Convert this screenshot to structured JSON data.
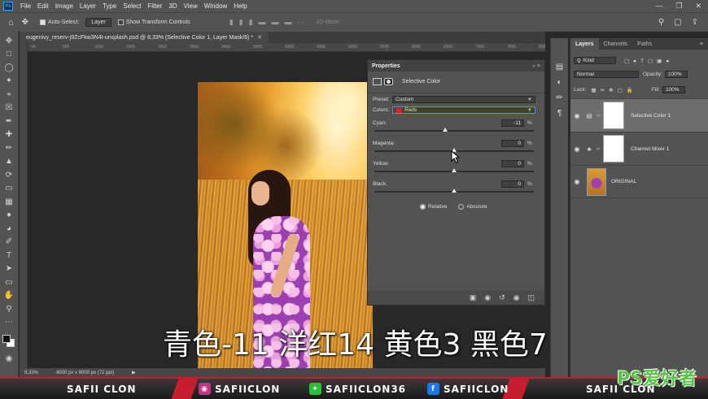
{
  "menubar": {
    "logo": "Ps",
    "items": [
      "File",
      "Edit",
      "Image",
      "Layer",
      "Type",
      "Select",
      "Filter",
      "3D",
      "View",
      "Window",
      "Help"
    ]
  },
  "options": {
    "auto_select_label": "Auto-Select:",
    "auto_select_value": "Layer",
    "transform_label": "Show Transform Controls",
    "mode_3d": "3D Mode:"
  },
  "document": {
    "tab_title": "eugenivy_reserv-j9ZcFkw3N4I-unsplash.psd @ 8,33% (Selective Color 1, Layer Mask/8) *",
    "ruler_ticks": [
      "00",
      "500",
      "1000",
      "1500",
      "2000",
      "2500",
      "3000",
      "3500",
      "4000",
      "4500",
      "5000",
      "5500",
      "6000",
      "6500",
      "7000",
      "7500",
      "8000"
    ],
    "zoom": "8,33%",
    "doc_info": "4000 px x 6000 px (72 ppi)"
  },
  "properties": {
    "panel_title": "Properties",
    "adjustment_name": "Selective Color",
    "preset_label": "Preset:",
    "preset_value": "Custom",
    "colors_label": "Colors:",
    "colors_value": "Reds",
    "sliders": [
      {
        "label": "Cyan:",
        "value": "-11",
        "unit": "%",
        "level": -11
      },
      {
        "label": "Magenta:",
        "value": "0",
        "unit": "%",
        "level": 0
      },
      {
        "label": "Yellow:",
        "value": "0",
        "unit": "%",
        "level": 0
      },
      {
        "label": "Black:",
        "value": "0",
        "unit": "%",
        "level": 0
      }
    ],
    "relative_label": "Relative",
    "absolute_label": "Absolute",
    "method": "Relative"
  },
  "layers_panel": {
    "tabs": [
      "Layers",
      "Channels",
      "Paths"
    ],
    "kind_label": "Kind",
    "blend_mode": "Normal",
    "opacity_label": "Opacity:",
    "opacity_value": "100%",
    "lock_label": "Lock:",
    "fill_label": "Fill:",
    "fill_value": "100%",
    "layers": [
      {
        "name": "Selective Color 1",
        "selected": true
      },
      {
        "name": "Channel Mixer 1",
        "selected": false
      },
      {
        "name": "ORIGINAL",
        "selected": false
      }
    ]
  },
  "subtitle": "青色-11 洋红14 黄色3 黑色7",
  "banner": {
    "brand": "SAFII CLON",
    "instagram": "SAFIICLON",
    "green_handle": "SAFIICLON36",
    "facebook": "SAFIICLON",
    "brand_right": "SAFII CLON"
  },
  "watermark": "PS爱好者",
  "colors": {
    "accent_red": "#c81d2c",
    "reds_swatch": "#d62222",
    "panel_bg": "#535353"
  }
}
